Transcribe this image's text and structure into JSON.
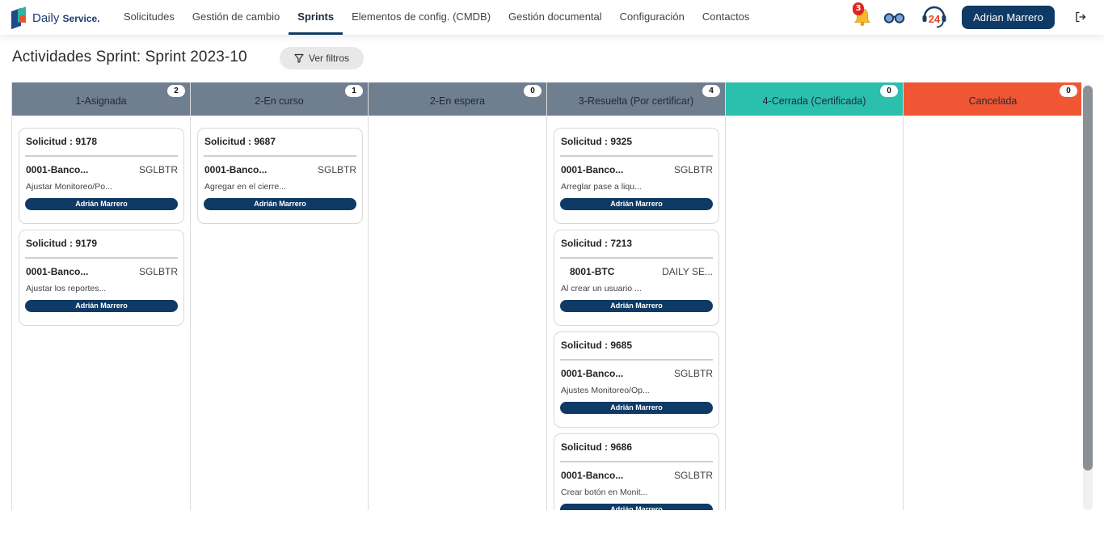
{
  "brand": {
    "name": "Daily",
    "suffix": "Service."
  },
  "nav": {
    "items": [
      {
        "label": "Solicitudes",
        "active": false
      },
      {
        "label": "Gestión de cambio",
        "active": false
      },
      {
        "label": "Sprints",
        "active": true
      },
      {
        "label": "Elementos de config. (CMDB)",
        "active": false
      },
      {
        "label": "Gestión documental",
        "active": false
      },
      {
        "label": "Configuración",
        "active": false
      },
      {
        "label": "Contactos",
        "active": false
      }
    ]
  },
  "toolbar": {
    "notifications_count": "3",
    "notifications_icon": "bell-icon",
    "view_icon": "glasses-icon",
    "support_icon": "support-24-icon",
    "support_label": "24",
    "user_name": "Adrian Marrero",
    "logout_icon": "logout-icon"
  },
  "page": {
    "title": "Actividades Sprint: Sprint 2023-10",
    "filter_label": "Ver filtros",
    "filter_icon": "filter-icon"
  },
  "colors": {
    "primary": "#0f3a66",
    "column_default": "#6f7f90",
    "column_closed": "#2bbfae",
    "column_cancelled": "#f05634"
  },
  "board": {
    "columns": [
      {
        "title": "1-Asignada",
        "count": "2",
        "color": "#6f7f90",
        "cards": [
          {
            "title": "Solicitud : 9178",
            "company": "0001-Banco...",
            "code": "SGLBTR",
            "desc": "Ajustar Monitoreo/Po...",
            "assignee": "Adrián Marrero"
          },
          {
            "title": "Solicitud : 9179",
            "company": "0001-Banco...",
            "code": "SGLBTR",
            "desc": "Ajustar los reportes...",
            "assignee": "Adrián Marrero"
          }
        ]
      },
      {
        "title": "2-En curso",
        "count": "1",
        "color": "#6f7f90",
        "cards": [
          {
            "title": "Solicitud : 9687",
            "company": "0001-Banco...",
            "code": "SGLBTR",
            "desc": "Agregar en el cierre...",
            "assignee": "Adrián Marrero"
          }
        ]
      },
      {
        "title": "2-En espera",
        "count": "0",
        "color": "#6f7f90",
        "cards": []
      },
      {
        "title": "3-Resuelta (Por certificar)",
        "count": "4",
        "color": "#6f7f90",
        "cards": [
          {
            "title": "Solicitud : 9325",
            "company": "0001-Banco...",
            "code": "SGLBTR",
            "desc": "Arreglar pase a liqu...",
            "assignee": "Adrián Marrero"
          },
          {
            "title": "Solicitud : 7213",
            "company": "8001-BTC",
            "code": "DAILY SE...",
            "desc": "Al crear un usuario ...",
            "assignee": "Adrián Marrero"
          },
          {
            "title": "Solicitud : 9685",
            "company": "0001-Banco...",
            "code": "SGLBTR",
            "desc": "Ajustes Monitoreo/Op...",
            "assignee": "Adrián Marrero"
          },
          {
            "title": "Solicitud : 9686",
            "company": "0001-Banco...",
            "code": "SGLBTR",
            "desc": "Crear botón en Monit...",
            "assignee": "Adrián Marrero"
          }
        ]
      },
      {
        "title": "4-Cerrada (Certificada)",
        "count": "0",
        "color": "#2bbfae",
        "cards": []
      },
      {
        "title": "Cancelada",
        "count": "0",
        "color": "#f05634",
        "cards": []
      }
    ]
  }
}
